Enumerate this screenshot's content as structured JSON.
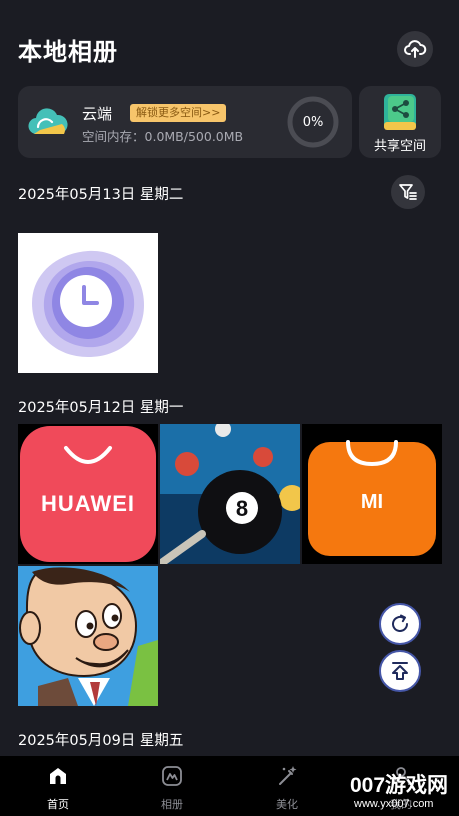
{
  "header": {
    "title": "本地相册",
    "upload_icon": "cloud-upload-icon"
  },
  "cloud": {
    "name": "云端",
    "unlock_badge": "解锁更多空间>>",
    "storage_label": "空间内存：",
    "storage_value": "0.0MB/500.0MB",
    "usage_percent": "0%",
    "usage_fraction": 0
  },
  "share": {
    "label": "共享空间",
    "icon": "share-book-icon"
  },
  "groups": [
    {
      "date": "2025年05月13日 星期二",
      "items": [
        {
          "icon": "clock-app-icon"
        }
      ]
    },
    {
      "date": "2025年05月12日 星期一",
      "items": [
        {
          "icon": "huawei-appgallery-icon",
          "text": "HUAWEI"
        },
        {
          "icon": "8-ball-pool-icon",
          "text": "8"
        },
        {
          "icon": "mi-store-icon",
          "text": "MI"
        },
        {
          "icon": "mr-bean-icon"
        }
      ]
    },
    {
      "date": "2025年05月09日 星期五",
      "items": []
    }
  ],
  "floating": {
    "refresh_icon": "refresh-icon",
    "top_icon": "back-to-top-icon"
  },
  "nav": [
    {
      "label": "首页",
      "icon": "home-icon",
      "active": true
    },
    {
      "label": "相册",
      "icon": "album-icon",
      "active": false
    },
    {
      "label": "美化",
      "icon": "magic-wand-icon",
      "active": false
    },
    {
      "label": "我的",
      "icon": "user-icon",
      "active": false
    }
  ],
  "watermark": {
    "main": "007游戏网",
    "sub": "www.yx007.com"
  },
  "colors": {
    "background": "#1b1c23",
    "card": "#2a2b32",
    "badge": "#f7c56b",
    "accent": "#4657a8"
  }
}
